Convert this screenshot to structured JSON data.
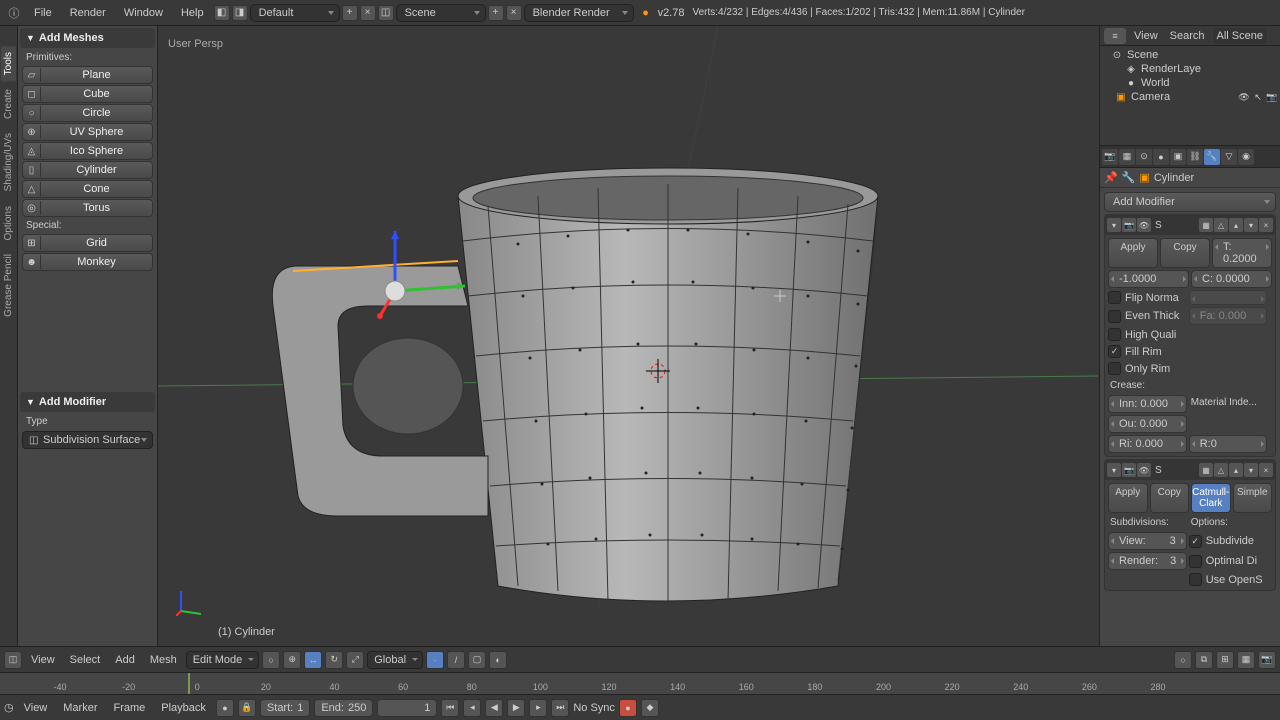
{
  "topbar": {
    "menus": [
      "File",
      "Render",
      "Window",
      "Help"
    ],
    "layout": "Default",
    "scene": "Scene",
    "engine": "Blender Render",
    "version": "v2.78",
    "stats": "Verts:4/232 | Edges:4/436 | Faces:1/202 | Tris:432 | Mem:11.86M | Cylinder"
  },
  "tool_panel": {
    "header": "Add Meshes",
    "primitives_label": "Primitives:",
    "primitives": [
      "Plane",
      "Cube",
      "Circle",
      "UV Sphere",
      "Ico Sphere",
      "Cylinder",
      "Cone",
      "Torus"
    ],
    "special_label": "Special:",
    "special": [
      "Grid",
      "Monkey"
    ],
    "add_modifier_header": "Add Modifier",
    "type_label": "Type",
    "type_value": "Subdivision Surface"
  },
  "left_tabs": [
    "Tools",
    "Create",
    "Shading/UVs",
    "Options",
    "Grease Pencil"
  ],
  "viewport": {
    "persp": "User Persp",
    "object_label": "(1) Cylinder"
  },
  "right_header": {
    "view": "View",
    "search": "Search",
    "all_scenes": "All Scene"
  },
  "outliner": {
    "scene": "Scene",
    "renderlayers": "RenderLaye",
    "world": "World",
    "camera": "Camera"
  },
  "breadcrumb": {
    "object": "Cylinder"
  },
  "modifier": {
    "add_label": "Add Modifier",
    "apply": "Apply",
    "copy": "Copy",
    "t_val": "T: 0.2000",
    "neg_val": "-1.0000",
    "c_val": "C: 0.0000",
    "flip_norm": "Flip Norma",
    "fa_val": "Fa: 0.000",
    "even_thick": "Even Thick",
    "high_qual": "High Quali",
    "fill_rim": "Fill Rim",
    "only_rim": "Only Rim",
    "crease": "Crease:",
    "inn": "Inn: 0.000",
    "ou": "Ou: 0.000",
    "mat_index": "Material Inde...",
    "ri": "Ri: 0.000",
    "r0": "R:0"
  },
  "modifier2": {
    "catmull": "Catmull-Clark",
    "simple": "Simple",
    "subdivisions": "Subdivisions:",
    "options": "Options:",
    "view": "View:",
    "view_val": "3",
    "render": "Render:",
    "render_val": "3",
    "subdivide": "Subdivide",
    "optimal": "Optimal Di",
    "opens": "Use OpenS"
  },
  "viewbar": {
    "menus": [
      "View",
      "Select",
      "Add",
      "Mesh"
    ],
    "mode": "Edit Mode",
    "orientation": "Global"
  },
  "timeline": {
    "ticks": [
      -40,
      -20,
      0,
      20,
      40,
      60,
      80,
      100,
      120,
      140,
      160,
      180,
      200,
      220,
      240,
      260,
      280
    ],
    "cursor_pos": 0
  },
  "timebar": {
    "menus": [
      "View",
      "Marker",
      "Frame",
      "Playback"
    ],
    "start_label": "Start:",
    "start": "1",
    "end_label": "End:",
    "end": "250",
    "current": "1",
    "sync": "No Sync"
  }
}
